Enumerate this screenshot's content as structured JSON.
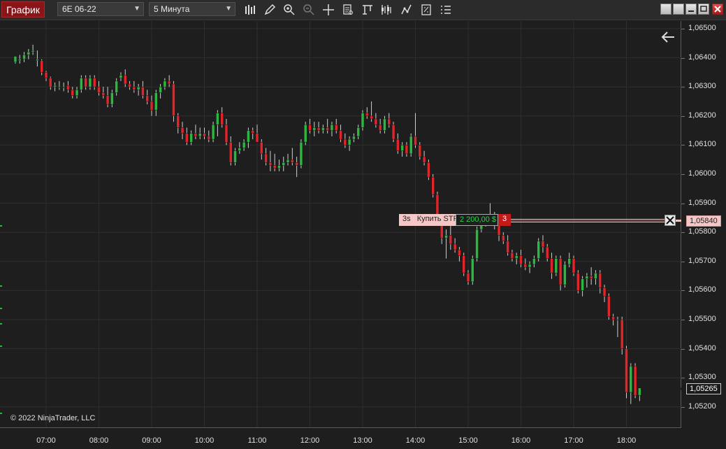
{
  "toolbar": {
    "title": "График",
    "instrument": "6E 06-22",
    "interval": "5 Минута",
    "tools": [
      "bars-icon",
      "pencil-icon",
      "zoom-in-icon",
      "zoom-out-icon",
      "crosshair-icon",
      "data-box-icon",
      "drawing-tools-icon",
      "indicators-icon",
      "strategies-icon",
      "templates-icon",
      "properties-icon"
    ]
  },
  "chart": {
    "copyright": "© 2022 NinjaTrader, LLC",
    "y_labels": [
      "1,06500",
      "1,06400",
      "1,06300",
      "1,06200",
      "1,06100",
      "1,06000",
      "1,05900",
      "1,05800",
      "1,05700",
      "1,05600",
      "1,05500",
      "1,05400",
      "1,05300",
      "1,05200"
    ],
    "x_labels": [
      "07:00",
      "08:00",
      "09:00",
      "10:00",
      "11:00",
      "12:00",
      "13:00",
      "14:00",
      "15:00",
      "16:00",
      "17:00",
      "18:00"
    ],
    "last_price": "1,05265",
    "order_price": "1,05840",
    "order": {
      "tif": "3s",
      "label": "Купить STP",
      "pnl": "2 200,00 $",
      "qty": "3"
    },
    "colors": {
      "up": "#2db640",
      "down": "#e0262a",
      "background": "#1e1e1e",
      "grid": "#2e2e2e",
      "order_line": "#f5c7c7"
    }
  },
  "chart_data": {
    "type": "candlestick",
    "title": "",
    "xlabel": "",
    "ylabel": "",
    "ylim": [
      1.0515,
      1.0651
    ],
    "x_ticks": [
      "07:00",
      "08:00",
      "09:00",
      "10:00",
      "11:00",
      "12:00",
      "13:00",
      "14:00",
      "15:00",
      "16:00",
      "17:00",
      "18:00"
    ],
    "bar_interval_minutes": 5,
    "candles": [
      [
        1.06385,
        1.06405,
        1.0638,
        1.06405
      ],
      [
        1.0639,
        1.0641,
        1.0638,
        1.06395
      ],
      [
        1.06395,
        1.0642,
        1.06385,
        1.0641
      ],
      [
        1.0641,
        1.0643,
        1.06395,
        1.0642
      ],
      [
        1.0642,
        1.06445,
        1.0641,
        1.06425
      ],
      [
        1.0639,
        1.06425,
        1.0637,
        1.06395
      ],
      [
        1.0639,
        1.06395,
        1.0634,
        1.0635
      ],
      [
        1.0635,
        1.06355,
        1.0632,
        1.0633
      ],
      [
        1.0633,
        1.06335,
        1.0629,
        1.063
      ],
      [
        1.063,
        1.06315,
        1.06285,
        1.06305
      ],
      [
        1.063,
        1.0632,
        1.0629,
        1.063
      ],
      [
        1.063,
        1.06315,
        1.06285,
        1.063
      ],
      [
        1.06305,
        1.0632,
        1.0628,
        1.0629
      ],
      [
        1.0629,
        1.063,
        1.0626,
        1.0627
      ],
      [
        1.0627,
        1.063,
        1.0626,
        1.0629
      ],
      [
        1.0629,
        1.0634,
        1.0628,
        1.0633
      ],
      [
        1.0633,
        1.0634,
        1.0629,
        1.063
      ],
      [
        1.063,
        1.0634,
        1.0629,
        1.0633
      ],
      [
        1.0633,
        1.0634,
        1.0629,
        1.063
      ],
      [
        1.063,
        1.0632,
        1.0627,
        1.0628
      ],
      [
        1.0628,
        1.063,
        1.0626,
        1.0627
      ],
      [
        1.0627,
        1.063,
        1.0623,
        1.0624
      ],
      [
        1.0624,
        1.0629,
        1.0623,
        1.0628
      ],
      [
        1.0628,
        1.0633,
        1.0627,
        1.0632
      ],
      [
        1.0633,
        1.0635,
        1.0632,
        1.0634
      ],
      [
        1.0634,
        1.0636,
        1.063,
        1.0631
      ],
      [
        1.0631,
        1.0632,
        1.0629,
        1.063
      ],
      [
        1.063,
        1.0632,
        1.0628,
        1.0629
      ],
      [
        1.0629,
        1.0631,
        1.0627,
        1.063
      ],
      [
        1.063,
        1.0632,
        1.0626,
        1.0627
      ],
      [
        1.0627,
        1.0629,
        1.0624,
        1.0625
      ],
      [
        1.0625,
        1.0627,
        1.062,
        1.0622
      ],
      [
        1.0622,
        1.0629,
        1.062,
        1.0628
      ],
      [
        1.0628,
        1.0631,
        1.0626,
        1.063
      ],
      [
        1.063,
        1.0633,
        1.0629,
        1.0632
      ],
      [
        1.0632,
        1.0634,
        1.063,
        1.0631
      ],
      [
        1.0631,
        1.0632,
        1.0618,
        1.062
      ],
      [
        1.062,
        1.0621,
        1.0614,
        1.0616
      ],
      [
        1.0616,
        1.0618,
        1.0612,
        1.0614
      ],
      [
        1.0614,
        1.0616,
        1.061,
        1.0611
      ],
      [
        1.0611,
        1.0615,
        1.061,
        1.0614
      ],
      [
        1.0614,
        1.0617,
        1.0612,
        1.0613
      ],
      [
        1.0613,
        1.0616,
        1.0612,
        1.0614
      ],
      [
        1.0614,
        1.0616,
        1.0612,
        1.0613
      ],
      [
        1.0613,
        1.0615,
        1.0611,
        1.0612
      ],
      [
        1.0612,
        1.0618,
        1.0611,
        1.0617
      ],
      [
        1.0617,
        1.0622,
        1.0613,
        1.0621
      ],
      [
        1.0621,
        1.0623,
        1.0616,
        1.0617
      ],
      [
        1.0617,
        1.0619,
        1.061,
        1.0611
      ],
      [
        1.0611,
        1.0613,
        1.0603,
        1.0604
      ],
      [
        1.0604,
        1.0609,
        1.0603,
        1.0608
      ],
      [
        1.0608,
        1.0611,
        1.0607,
        1.0609
      ],
      [
        1.0609,
        1.0612,
        1.0608,
        1.0611
      ],
      [
        1.0611,
        1.0616,
        1.0609,
        1.0615
      ],
      [
        1.0615,
        1.0616,
        1.0612,
        1.0614
      ],
      [
        1.0614,
        1.0617,
        1.0611,
        1.0611
      ],
      [
        1.0611,
        1.0612,
        1.0605,
        1.0607
      ],
      [
        1.0607,
        1.0609,
        1.0603,
        1.0604
      ],
      [
        1.0604,
        1.0608,
        1.0601,
        1.0603
      ],
      [
        1.0603,
        1.0607,
        1.0601,
        1.0602
      ],
      [
        1.0602,
        1.0605,
        1.0601,
        1.0603
      ],
      [
        1.0603,
        1.0606,
        1.0601,
        1.0604
      ],
      [
        1.0604,
        1.0607,
        1.0603,
        1.0605
      ],
      [
        1.0605,
        1.0609,
        1.0603,
        1.0604
      ],
      [
        1.0604,
        1.0606,
        1.0599,
        1.0603
      ],
      [
        1.0603,
        1.0612,
        1.0602,
        1.0611
      ],
      [
        1.0611,
        1.0618,
        1.061,
        1.0617
      ],
      [
        1.0617,
        1.0619,
        1.0614,
        1.0615
      ],
      [
        1.0615,
        1.0618,
        1.0613,
        1.0616
      ],
      [
        1.0616,
        1.0618,
        1.0614,
        1.0615
      ],
      [
        1.0615,
        1.0617,
        1.0614,
        1.0616
      ],
      [
        1.0616,
        1.0619,
        1.0614,
        1.0615
      ],
      [
        1.0615,
        1.0618,
        1.0613,
        1.0617
      ],
      [
        1.0617,
        1.0619,
        1.0614,
        1.0615
      ],
      [
        1.0615,
        1.0617,
        1.0611,
        1.0612
      ],
      [
        1.0612,
        1.0614,
        1.0609,
        1.061
      ],
      [
        1.061,
        1.0613,
        1.0608,
        1.0612
      ],
      [
        1.0612,
        1.0614,
        1.0611,
        1.0613
      ],
      [
        1.0613,
        1.0617,
        1.0612,
        1.0616
      ],
      [
        1.0616,
        1.0622,
        1.0615,
        1.0621
      ],
      [
        1.0621,
        1.0623,
        1.0619,
        1.062
      ],
      [
        1.062,
        1.0625,
        1.0618,
        1.0619
      ],
      [
        1.0619,
        1.0621,
        1.0616,
        1.0617
      ],
      [
        1.0617,
        1.0619,
        1.0614,
        1.0615
      ],
      [
        1.0615,
        1.062,
        1.0614,
        1.0619
      ],
      [
        1.0619,
        1.0621,
        1.0616,
        1.0617
      ],
      [
        1.0617,
        1.0618,
        1.0611,
        1.0612
      ],
      [
        1.0612,
        1.0614,
        1.0607,
        1.0608
      ],
      [
        1.0608,
        1.0611,
        1.0606,
        1.061
      ],
      [
        1.061,
        1.0611,
        1.0606,
        1.0607
      ],
      [
        1.0607,
        1.0614,
        1.0606,
        1.0613
      ],
      [
        1.0613,
        1.0621,
        1.0609,
        1.061
      ],
      [
        1.061,
        1.0611,
        1.0605,
        1.0606
      ],
      [
        1.0606,
        1.0608,
        1.0603,
        1.0604
      ],
      [
        1.0604,
        1.0605,
        1.0598,
        1.0599
      ],
      [
        1.0599,
        1.06,
        1.0592,
        1.0593
      ],
      [
        1.0593,
        1.0594,
        1.0584,
        1.0585
      ],
      [
        1.0585,
        1.0586,
        1.0576,
        1.0578
      ],
      [
        1.0578,
        1.0581,
        1.0571,
        1.0579
      ],
      [
        1.0579,
        1.0583,
        1.0574,
        1.0576
      ],
      [
        1.0576,
        1.0578,
        1.0573,
        1.0574
      ],
      [
        1.0574,
        1.0575,
        1.057,
        1.0572
      ],
      [
        1.0572,
        1.0573,
        1.0565,
        1.0566
      ],
      [
        1.0566,
        1.0567,
        1.0562,
        1.0563
      ],
      [
        1.0563,
        1.0572,
        1.0562,
        1.0571
      ],
      [
        1.0571,
        1.0582,
        1.057,
        1.0581
      ],
      [
        1.0581,
        1.0586,
        1.058,
        1.0585
      ],
      [
        1.0585,
        1.0586,
        1.0582,
        1.0584
      ],
      [
        1.0584,
        1.059,
        1.0583,
        1.0585
      ],
      [
        1.0585,
        1.0587,
        1.0581,
        1.0583
      ],
      [
        1.0583,
        1.0586,
        1.0577,
        1.0579
      ],
      [
        1.0579,
        1.058,
        1.0576,
        1.0577
      ],
      [
        1.0577,
        1.0579,
        1.0572,
        1.0573
      ],
      [
        1.0573,
        1.0574,
        1.057,
        1.0571
      ],
      [
        1.0571,
        1.0573,
        1.0569,
        1.0572
      ],
      [
        1.0572,
        1.0574,
        1.0568,
        1.0569
      ],
      [
        1.0569,
        1.0571,
        1.0567,
        1.0568
      ],
      [
        1.0568,
        1.057,
        1.0566,
        1.0569
      ],
      [
        1.0569,
        1.0572,
        1.0568,
        1.0571
      ],
      [
        1.0571,
        1.0578,
        1.057,
        1.0577
      ],
      [
        1.0577,
        1.0579,
        1.0573,
        1.0575
      ],
      [
        1.0575,
        1.0576,
        1.057,
        1.0571
      ],
      [
        1.0571,
        1.0573,
        1.0564,
        1.0566
      ],
      [
        1.0566,
        1.0572,
        1.0565,
        1.0571
      ],
      [
        1.0571,
        1.0572,
        1.056,
        1.0562
      ],
      [
        1.0562,
        1.057,
        1.0561,
        1.0569
      ],
      [
        1.0569,
        1.0573,
        1.0568,
        1.0571
      ],
      [
        1.0571,
        1.0572,
        1.0565,
        1.0566
      ],
      [
        1.0566,
        1.0567,
        1.0559,
        1.056
      ],
      [
        1.056,
        1.0565,
        1.0558,
        1.0564
      ],
      [
        1.0564,
        1.0566,
        1.0561,
        1.0565
      ],
      [
        1.0565,
        1.0568,
        1.0562,
        1.0564
      ],
      [
        1.0564,
        1.0567,
        1.0562,
        1.0566
      ],
      [
        1.0566,
        1.0567,
        1.0559,
        1.0561
      ],
      [
        1.0561,
        1.0562,
        1.0556,
        1.0558
      ],
      [
        1.0558,
        1.0559,
        1.055,
        1.0551
      ],
      [
        1.0551,
        1.0552,
        1.0548,
        1.055
      ],
      [
        1.055,
        1.0551,
        1.0544,
        1.055
      ],
      [
        1.055,
        1.0551,
        1.0538,
        1.054
      ],
      [
        1.054,
        1.0541,
        1.0523,
        1.0525
      ],
      [
        1.0525,
        1.0535,
        1.0521,
        1.0534
      ],
      [
        1.0534,
        1.0535,
        1.0523,
        1.0524
      ],
      [
        1.0524,
        1.0526,
        1.0522,
        1.05265
      ]
    ],
    "candle_fields": [
      "open",
      "high",
      "low",
      "close"
    ]
  }
}
